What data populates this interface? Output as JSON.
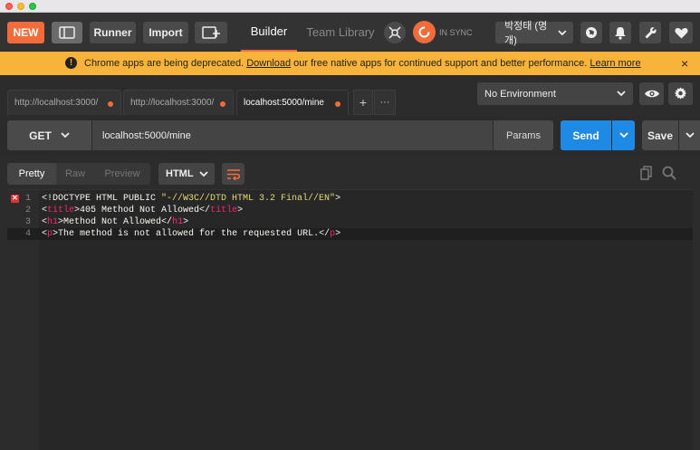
{
  "toolbar": {
    "new_label": "NEW",
    "runner_label": "Runner",
    "import_label": "Import",
    "builder_tab": "Builder",
    "team_library_tab": "Team Library",
    "sync_label": "IN SYNC",
    "user_label": "박정태 (명개)",
    "accent_color": "#f26b3a"
  },
  "banner": {
    "text_before": "Chrome apps are being deprecated.",
    "link_download": "Download",
    "text_middle": "our free native apps for continued support and better performance.",
    "link_learn": "Learn more",
    "close": "×",
    "background": "#f8b43a"
  },
  "tabs": {
    "items": [
      {
        "label": "http://localhost:3000/",
        "active": false
      },
      {
        "label": "http://localhost:3000/",
        "active": false
      },
      {
        "label": "localhost:5000/mine",
        "active": true
      }
    ],
    "add": "+",
    "more": "···"
  },
  "environment": {
    "selected": "No Environment"
  },
  "request": {
    "method": "GET",
    "url": "localhost:5000/mine",
    "params_label": "Params",
    "send_label": "Send",
    "save_label": "Save",
    "send_color": "#1f8ae6"
  },
  "response": {
    "view_tabs": [
      "Pretty",
      "Raw",
      "Preview"
    ],
    "active_view": "Pretty",
    "language": "HTML"
  },
  "editor": {
    "lines": [
      {
        "num": "1",
        "has_error": true,
        "parts": [
          {
            "t": "<!DOCTYPE HTML PUBLIC ",
            "c": "plain"
          },
          {
            "t": "\"-//W3C//DTD HTML 3.2 Final//EN\"",
            "c": "str"
          },
          {
            "t": ">",
            "c": "plain"
          }
        ]
      },
      {
        "num": "2",
        "has_error": false,
        "parts": [
          {
            "t": "<",
            "c": "plain"
          },
          {
            "t": "title",
            "c": "tag"
          },
          {
            "t": ">405 Method Not Allowed</",
            "c": "plain"
          },
          {
            "t": "title",
            "c": "tag"
          },
          {
            "t": ">",
            "c": "plain"
          }
        ]
      },
      {
        "num": "3",
        "has_error": false,
        "parts": [
          {
            "t": "<",
            "c": "plain"
          },
          {
            "t": "h1",
            "c": "tag"
          },
          {
            "t": ">Method Not Allowed</",
            "c": "plain"
          },
          {
            "t": "h1",
            "c": "tag"
          },
          {
            "t": ">",
            "c": "plain"
          }
        ]
      },
      {
        "num": "4",
        "has_error": false,
        "parts": [
          {
            "t": "<",
            "c": "plain"
          },
          {
            "t": "p",
            "c": "tag"
          },
          {
            "t": ">The method is not allowed for the requested URL.</",
            "c": "plain"
          },
          {
            "t": "p",
            "c": "tag"
          },
          {
            "t": ">",
            "c": "plain"
          }
        ]
      }
    ],
    "active_line": "4"
  }
}
